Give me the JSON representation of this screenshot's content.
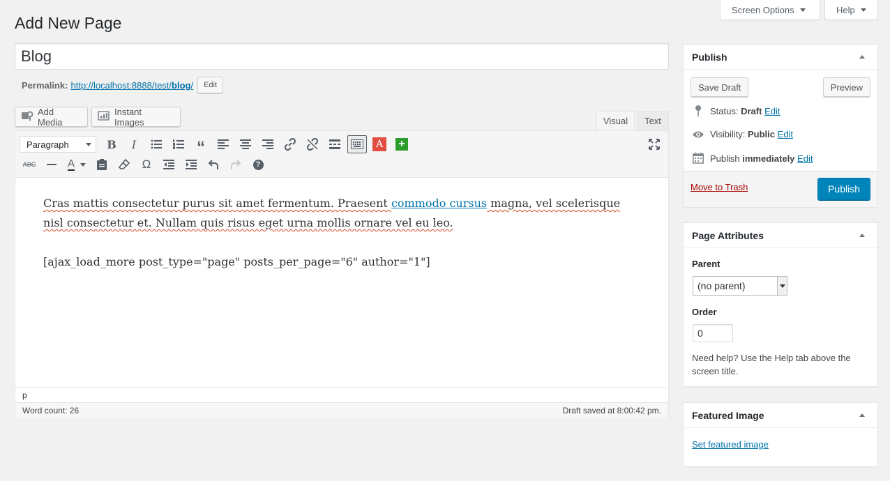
{
  "screen_meta": {
    "screen_options": "Screen Options",
    "help": "Help"
  },
  "page_title": "Add New Page",
  "post_title": "Blog",
  "permalink": {
    "label": "Permalink:",
    "url_base": "http://localhost:8888/test/",
    "slug": "blog",
    "url_end": "/",
    "edit_button": "Edit"
  },
  "media_buttons": {
    "add_media": "Add Media",
    "instant_images": "Instant Images"
  },
  "editor_tabs": {
    "visual": "Visual",
    "text": "Text"
  },
  "toolbar": {
    "format": "Paragraph"
  },
  "content": {
    "p1_before": "Cras mattis consectetur purus sit amet fermentum. Praesent ",
    "p1_link": "commodo cursus",
    "p1_after1": " magna, vel scelerisque",
    "p1_line2": "nisl consectetur et. Nullam quis risus eget urna mollis ornare vel eu leo.",
    "shortcode": "[ajax_load_more post_type=\"page\" posts_per_page=\"6\" author=\"1\"]"
  },
  "path": "p",
  "status_bar": {
    "word_count": "Word count: 26",
    "draft_saved": "Draft saved at 8:00:42 pm."
  },
  "publish_box": {
    "title": "Publish",
    "save_draft": "Save Draft",
    "preview": "Preview",
    "status_label": "Status:",
    "status_value": "Draft",
    "visibility_label": "Visibility:",
    "visibility_value": "Public",
    "publish_label": "Publish",
    "publish_value": "immediately",
    "edit": "Edit",
    "move_to_trash": "Move to Trash",
    "publish_button": "Publish"
  },
  "page_attributes": {
    "title": "Page Attributes",
    "parent_label": "Parent",
    "parent_value": "(no parent)",
    "order_label": "Order",
    "order_value": "0",
    "help": "Need help? Use the Help tab above the screen title."
  },
  "featured_image": {
    "title": "Featured Image",
    "link": "Set featured image"
  },
  "colors": {
    "primary": "#0085ba",
    "link": "#0073aa",
    "trash": "#a00000"
  }
}
